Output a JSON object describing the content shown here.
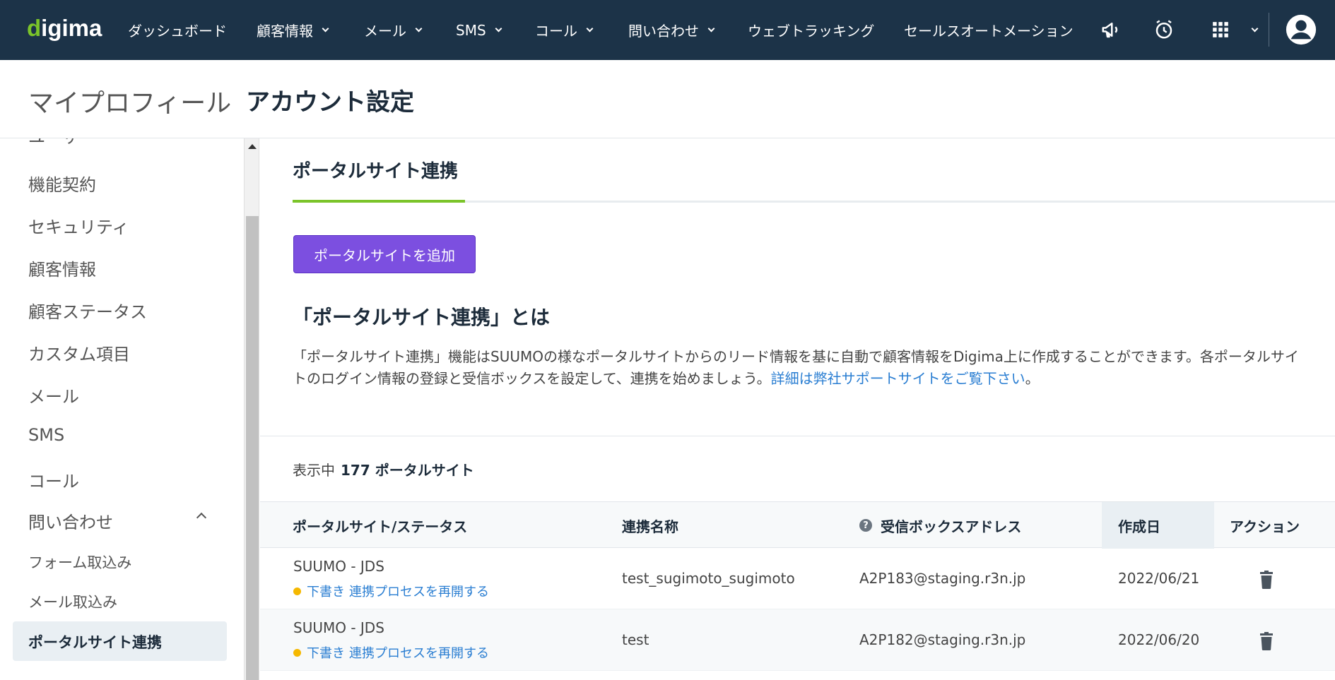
{
  "nav": {
    "logo_text_d": "d",
    "logo_text_rest": "igima",
    "items": [
      {
        "label": "ダッシュボード"
      },
      {
        "label": "顧客情報"
      },
      {
        "label": "メール"
      },
      {
        "label": "SMS"
      },
      {
        "label": "コール"
      },
      {
        "label": "問い合わせ"
      },
      {
        "label": "ウェブトラッキング"
      },
      {
        "label": "セールスオートメーション"
      }
    ],
    "icons": [
      "megaphone-icon",
      "alarm-clock-icon",
      "apps-grid-icon",
      "user-avatar-icon"
    ]
  },
  "header": {
    "crumb1": "マイプロフィール",
    "crumb2": "アカウント設定"
  },
  "sidebar": {
    "items": [
      {
        "label": "ユーザー"
      },
      {
        "label": "機能契約"
      },
      {
        "label": "セキュリティ"
      },
      {
        "label": "顧客情報"
      },
      {
        "label": "顧客ステータス"
      },
      {
        "label": "カスタム項目"
      },
      {
        "label": "メール"
      },
      {
        "label": "SMS"
      },
      {
        "label": "コール"
      },
      {
        "label": "問い合わせ"
      }
    ],
    "sub_items": [
      {
        "label": "フォーム取込み"
      },
      {
        "label": "メール取込み"
      }
    ],
    "active": "ポータルサイト連携"
  },
  "main": {
    "tab_title": "ポータルサイト連携",
    "add_button": "ポータルサイトを追加",
    "about_title": "「ポータルサイト連携」とは",
    "about_text": "「ポータルサイト連携」機能はSUUMOの様なポータルサイトからのリード情報を基に自動で顧客情報をDigima上に作成することができます。各ポータルサイトのログイン情報の登録と受信ボックスを設定して、連携を始めましょう。",
    "about_link": "詳細は弊社サポートサイトをご覧下さい",
    "about_period": "。",
    "count_label": "表示中",
    "count_value": "177 ポータルサイト"
  },
  "table": {
    "headers": {
      "portal": "ポータルサイト/ステータス",
      "name": "連携名称",
      "inbox": "受信ボックスアドレス",
      "date": "作成日",
      "action": "アクション"
    },
    "rows": [
      {
        "portal": "SUUMO - JDS",
        "status": "下書き",
        "resume": "連携プロセスを再開する",
        "name": "test_sugimoto_sugimoto",
        "inbox": "A2P183@staging.r3n.jp",
        "date": "2022/06/21"
      },
      {
        "portal": "SUUMO - JDS",
        "status": "下書き",
        "resume": "連携プロセスを再開する",
        "name": "test",
        "inbox": "A2P182@staging.r3n.jp",
        "date": "2022/06/20"
      }
    ]
  },
  "colors": {
    "nav_bg": "#1c3348",
    "accent_green": "#7bc42a",
    "button_purple": "#7c4fe0",
    "link_blue": "#2a7ed2",
    "status_yellow": "#f5b800"
  }
}
